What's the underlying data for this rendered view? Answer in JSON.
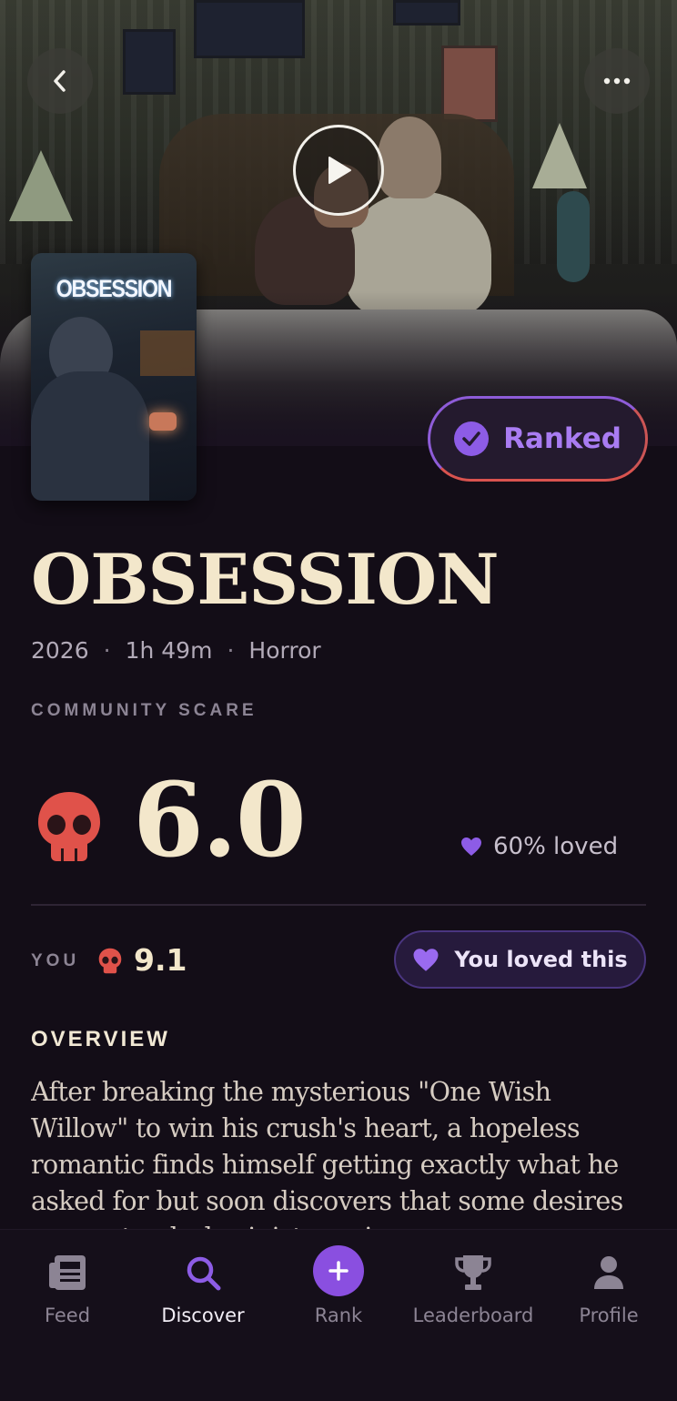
{
  "movie": {
    "poster_title": "OBSESSION",
    "title": "OBSESSION",
    "year": "2026",
    "runtime": "1h 49m",
    "genre": "Horror",
    "meta_separator": "·",
    "ranked_label": "Ranked"
  },
  "community": {
    "label": "COMMUNITY SCARE",
    "score": "6.0",
    "loved": "60% loved"
  },
  "you": {
    "label": "YOU",
    "score": "9.1",
    "loved_label": "You loved this"
  },
  "overview": {
    "heading": "OVERVIEW",
    "text": "After breaking the mysterious \"One Wish Willow\" to win his crush's heart, a hopeless romantic finds himself getting exactly what he asked for but soon discovers that some desires come at a dark, sinister price."
  },
  "nav": {
    "items": [
      {
        "label": "Feed",
        "icon": "feed-icon"
      },
      {
        "label": "Discover",
        "icon": "search-icon"
      },
      {
        "label": "Rank",
        "icon": "plus-icon"
      },
      {
        "label": "Leaderboard",
        "icon": "trophy-icon"
      },
      {
        "label": "Profile",
        "icon": "person-icon"
      }
    ],
    "active": "Discover"
  },
  "colors": {
    "background": "#130d17",
    "accent_purple": "#8d5ce6",
    "skull_red": "#e0524a",
    "title_cream": "#f3e7cb"
  }
}
